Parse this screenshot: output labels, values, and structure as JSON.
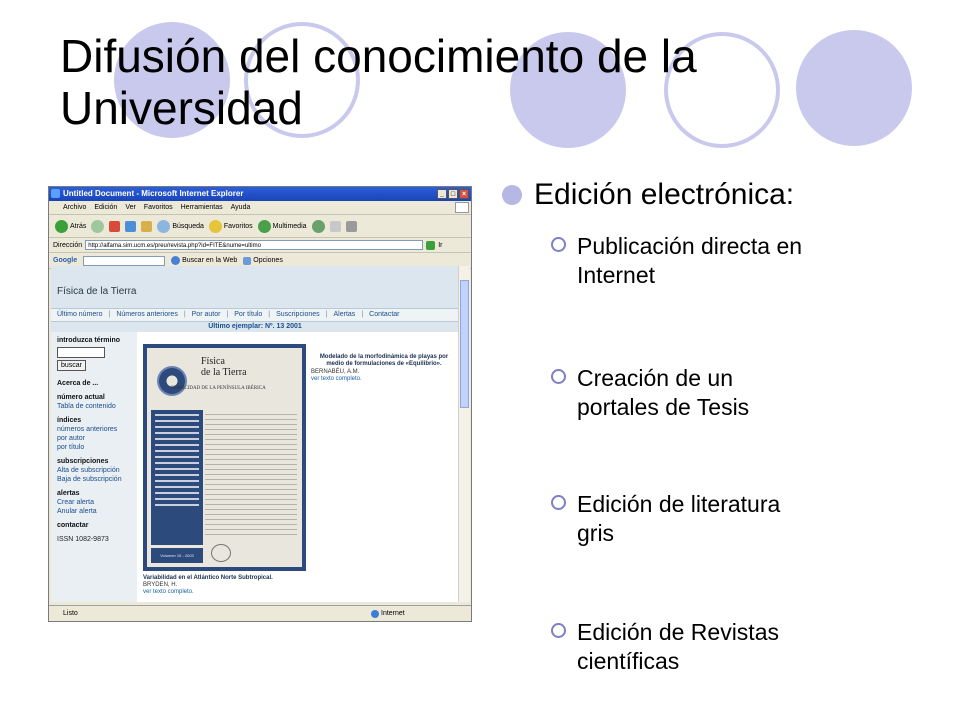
{
  "slide": {
    "title_line1": "Difusión del conocimiento de la",
    "title_line2": "Universidad",
    "bullet": "Edición electrónica:",
    "sub_items": [
      {
        "line1": "Publicación directa en",
        "line2": "Internet"
      },
      {
        "line1": "Creación de un",
        "line2": "portales de Tesis"
      },
      {
        "line1": "Edición de literatura",
        "line2": "gris"
      },
      {
        "line1": "Edición de Revistas",
        "line2": "científicas"
      }
    ],
    "colors": {
      "accent_circle": "#c9c9ee",
      "bullet": "#b7b7e6",
      "sub_bullet_ring": "#7f7fc8"
    }
  },
  "browser": {
    "window_title": "Untitled Document - Microsoft Internet Explorer",
    "menu": [
      "Archivo",
      "Edición",
      "Ver",
      "Favoritos",
      "Herramientas",
      "Ayuda"
    ],
    "toolbar": {
      "back": "Atrás",
      "search": "Búsqueda",
      "favorites": "Favoritos",
      "multimedia": "Multimedia"
    },
    "address_label": "Dirección",
    "address": "http://alfama.sim.ucm.es/preu/revista.php?id=FITE&nume=ultimo",
    "go_label": "Ir",
    "google": {
      "logo": "Google",
      "search_web": "Buscar en la Web",
      "options": "Opciones"
    },
    "status": "Listo",
    "zone": "Internet"
  },
  "site": {
    "title": "Física de la Tierra",
    "nav": [
      "Último número",
      "Números anteriores",
      "Por autor",
      "Por título",
      "Suscripciones",
      "Alertas",
      "Contactar"
    ],
    "issue": "Último ejemplar: Nº. 13 2001",
    "sidebar": {
      "search_heading": "introduzca término",
      "search_button": "buscar",
      "about": "Acerca de ...",
      "current_heading": "número actual",
      "toc": "Tabla de contenido",
      "indexes_heading": "índices",
      "prev_numbers": "números anteriores",
      "by_author": "por autor",
      "by_title": "por título",
      "subs_heading": "subscripciones",
      "sub_up": "Alta de subscripción",
      "sub_down": "Baja de subscripción",
      "alerts_heading": "alertas",
      "alert_create": "Crear alerta",
      "alert_cancel": "Anular alerta",
      "contact_heading": "contactar",
      "issn": "ISSN 1082-9873"
    },
    "cover": {
      "title_line1": "Física",
      "title_line2": "de la Tierra",
      "subtitle": "SISMICIDAD DE LA PENÍNSULA IBÉRICA",
      "volume": "Volumen 15 - 2003"
    },
    "articles": [
      {
        "title": "Modelado de la morfodinámica de playas por medio de formulaciones de «Equilibrio».",
        "author": "BERNABÉU, A.M.",
        "link": "ver texto completo."
      },
      {
        "title": "Variabilidad en el Atlántico Norte Subtropical.",
        "author": "BRYDEN, H.",
        "link": "ver texto completo."
      }
    ]
  }
}
